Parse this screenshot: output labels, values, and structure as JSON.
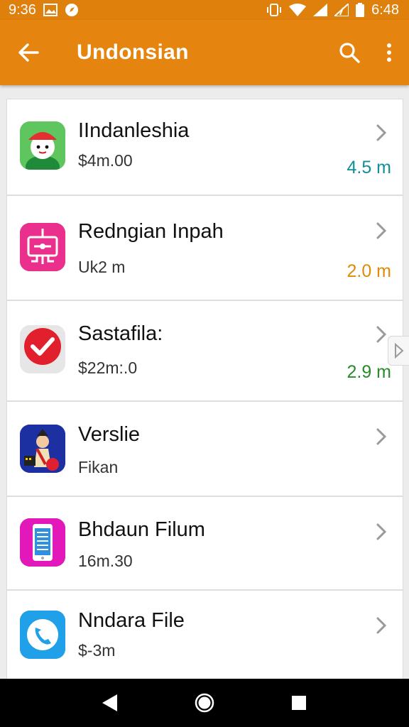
{
  "status_bar": {
    "time_left": "9:36",
    "time_right": "6:48"
  },
  "app_bar": {
    "title": "Undonsian"
  },
  "items": [
    {
      "title": "IIndanleshia",
      "subtitle": "$4m.00",
      "size": "4.5 m",
      "size_color": "#108f9a",
      "icon": "character-red-hat-icon"
    },
    {
      "title": "Redngian Inpah",
      "subtitle": "Uk2 m",
      "size": "2.0 m",
      "size_color": "#e08a0a",
      "icon": "device-tree-icon"
    },
    {
      "title": "Sastafila:",
      "subtitle": "$22m:.0",
      "size": "2.9 m",
      "size_color": "#2a8a2a",
      "icon": "checkmark-icon"
    },
    {
      "title": "Verslie",
      "subtitle": "Fikan",
      "size": "",
      "size_color": "",
      "icon": "traveler-character-icon"
    },
    {
      "title": "Bhdaun Filum",
      "subtitle": "16m.30",
      "size": "",
      "size_color": "",
      "icon": "phone-document-icon"
    },
    {
      "title": "Nndara File",
      "subtitle": "$-3m",
      "size": "",
      "size_color": "",
      "icon": "phone-call-icon"
    }
  ],
  "colors": {
    "app_bar": "#e5850f",
    "status_bar": "#e0800c"
  }
}
